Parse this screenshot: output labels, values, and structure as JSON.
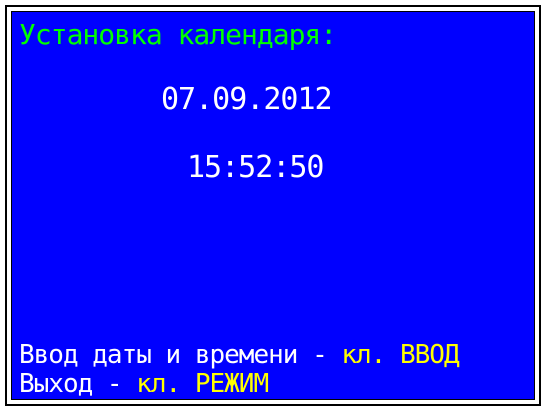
{
  "title": "Установка календаря:",
  "date": "07.09.2012",
  "time": "15:52:50",
  "hints": [
    {
      "text": "Ввод даты и времени - ",
      "key": "кл. ВВОД"
    },
    {
      "text": "Выход - ",
      "key": "кл. РЕЖИМ"
    }
  ],
  "colors": {
    "background": "#0000ff",
    "title": "#00ff00",
    "value": "#ffffff",
    "key": "#ffff00"
  }
}
